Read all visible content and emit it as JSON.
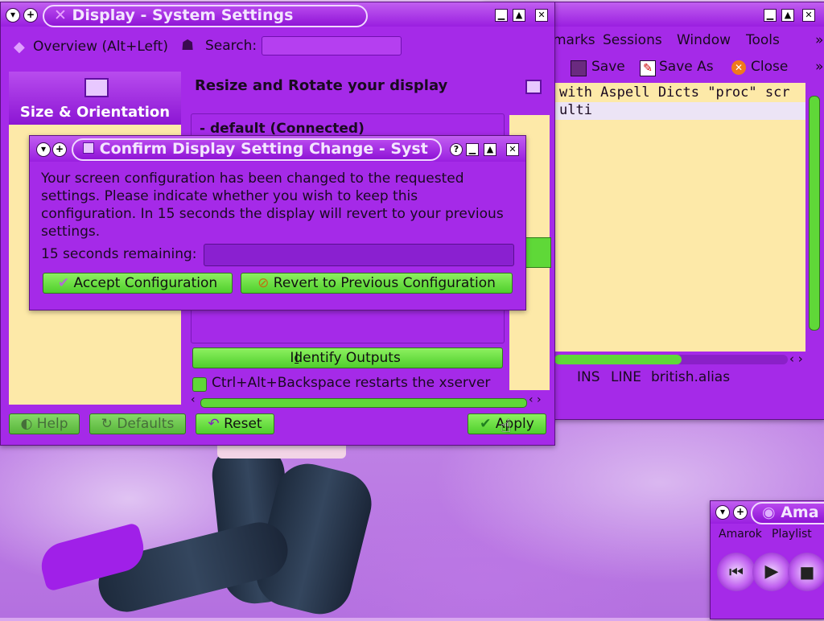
{
  "display_window": {
    "title": "Display - System Settings",
    "toolbar": {
      "overview_label": "Overview (Alt+Left)",
      "search_label": "Search:",
      "search_value": ""
    },
    "sidebar": {
      "active_item": "Size & Orientation"
    },
    "main": {
      "heading": "Resize and Rotate your display",
      "output_name": "default (Connected)",
      "identify_label": "Identify Outputs",
      "checkbox_label": "Ctrl+Alt+Backspace restarts the xserver"
    },
    "buttons": {
      "help": "Help",
      "defaults": "Defaults",
      "reset": "Reset",
      "apply": "Apply"
    }
  },
  "editor_window": {
    "menu": [
      "marks",
      "Sessions",
      "Window",
      "Tools"
    ],
    "toolbar": {
      "save": "Save",
      "save_as": "Save As",
      "close": "Close"
    },
    "lines": [
      "with Aspell Dicts \"proc\" scr",
      "ulti"
    ],
    "status": {
      "mode": "INS",
      "line": "LINE",
      "file": "british.alias"
    }
  },
  "dialog": {
    "title": "Confirm Display Setting Change - Syst",
    "message": "Your screen configuration has been changed to the requested settings. Please indicate whether you wish to keep this configuration. In 15 seconds the display will revert to your previous settings.",
    "remaining_label": "15 seconds remaining:",
    "progress": 0,
    "accept_label": "Accept Configuration",
    "revert_label": "Revert to Previous Configuration"
  },
  "amarok": {
    "title": "Ama",
    "menu": [
      "Amarok",
      "Playlist"
    ]
  },
  "colors": {
    "accent": "#a52ae8",
    "button_green": "#4fcf2c",
    "pane_yellow": "#fde9a8"
  }
}
